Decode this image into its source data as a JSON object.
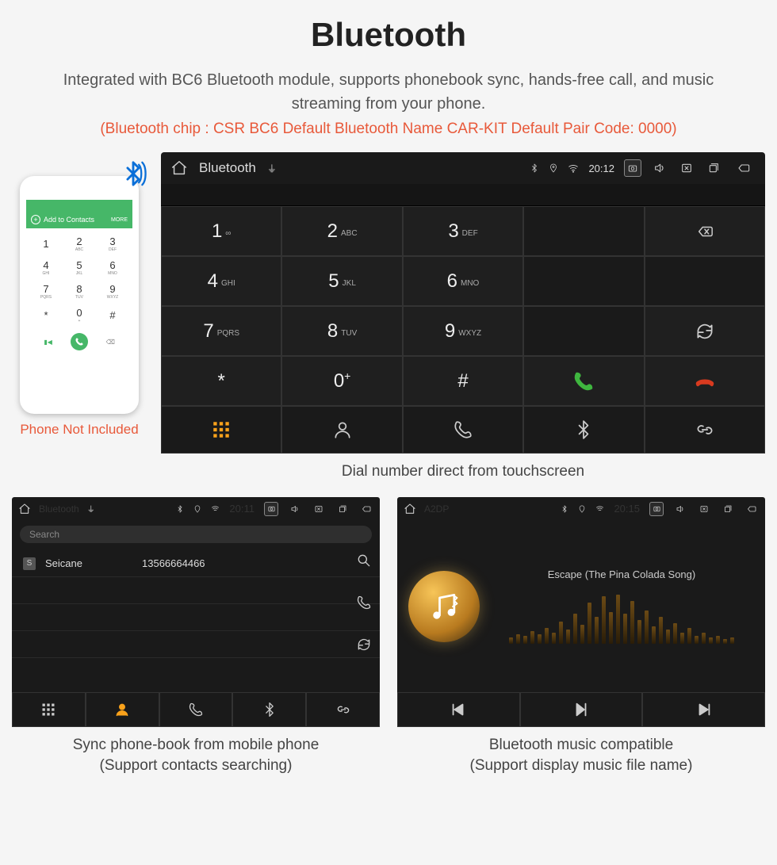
{
  "title": "Bluetooth",
  "desc": "Integrated with BC6 Bluetooth module, supports phonebook sync, hands-free call, and music streaming from your phone.",
  "spec": "(Bluetooth chip : CSR BC6    Default Bluetooth Name CAR-KIT    Default Pair Code: 0000)",
  "phone": {
    "add_label": "Add to Contacts",
    "more": "MORE",
    "caption": "Phone Not Included",
    "keys": [
      {
        "n": "1",
        "l": ""
      },
      {
        "n": "2",
        "l": "ABC"
      },
      {
        "n": "3",
        "l": "DEF"
      },
      {
        "n": "4",
        "l": "GHI"
      },
      {
        "n": "5",
        "l": "JKL"
      },
      {
        "n": "6",
        "l": "MNO"
      },
      {
        "n": "7",
        "l": "PQRS"
      },
      {
        "n": "8",
        "l": "TUV"
      },
      {
        "n": "9",
        "l": "WXYZ"
      },
      {
        "n": "*",
        "l": ""
      },
      {
        "n": "0",
        "l": "+"
      },
      {
        "n": "#",
        "l": ""
      }
    ]
  },
  "dialer": {
    "header_title": "Bluetooth",
    "time": "20:12",
    "keys": [
      {
        "n": "1",
        "l": "∞"
      },
      {
        "n": "2",
        "l": "ABC"
      },
      {
        "n": "3",
        "l": "DEF"
      },
      {
        "n": "4",
        "l": "GHI"
      },
      {
        "n": "5",
        "l": "JKL"
      },
      {
        "n": "6",
        "l": "MNO"
      },
      {
        "n": "7",
        "l": "PQRS"
      },
      {
        "n": "8",
        "l": "TUV"
      },
      {
        "n": "9",
        "l": "WXYZ"
      },
      {
        "n": "*",
        "l": ""
      },
      {
        "n": "0",
        "l": "+"
      },
      {
        "n": "#",
        "l": ""
      }
    ],
    "caption": "Dial number direct from touchscreen"
  },
  "contacts": {
    "header_title": "Bluetooth",
    "time": "20:11",
    "search_placeholder": "Search",
    "list": [
      {
        "badge": "S",
        "name": "Seicane",
        "number": "13566664466"
      }
    ],
    "caption1": "Sync phone-book from mobile phone",
    "caption2": "(Support contacts searching)"
  },
  "music": {
    "header_title": "A2DP",
    "time": "20:15",
    "track": "Escape (The Pina Colada Song)",
    "caption1": "Bluetooth music compatible",
    "caption2": "(Support display music file name)"
  },
  "colors": {
    "accent": "#faa21b",
    "call": "#3fb63f",
    "hangup": "#d83a1f",
    "spec": "#e8593a"
  }
}
